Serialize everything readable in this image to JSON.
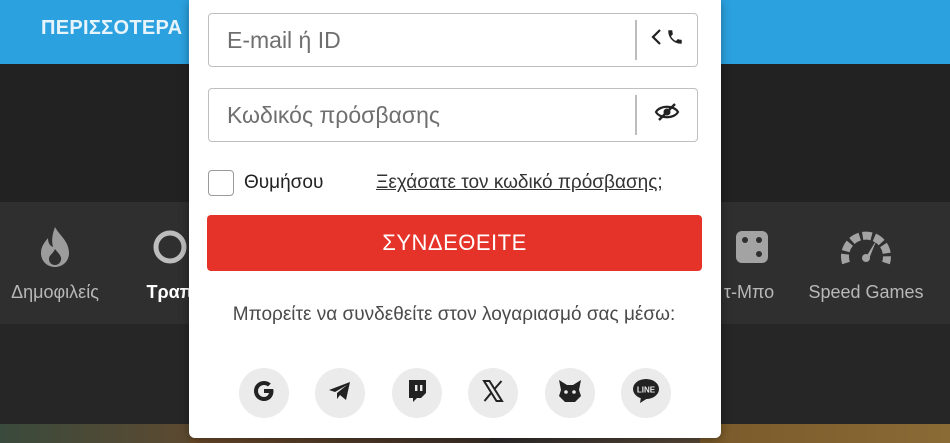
{
  "topbar": {
    "label": "ΠΕΡΙΣΣΟΤΕΡΑ"
  },
  "categories": [
    {
      "label": "Δημοφιλείς",
      "icon": "fire-icon"
    },
    {
      "label": "Τραπ",
      "icon": "cards-icon",
      "active": true
    },
    {
      "label": "τ-Μπο",
      "icon": "dice-icon"
    },
    {
      "label": "Speed Games",
      "icon": "speedometer-icon"
    }
  ],
  "login": {
    "email_placeholder": "E-mail ή ID",
    "password_placeholder": "Κωδικός πρόσβασης",
    "remember_label": "Θυμήσου",
    "forgot_link": "Ξεχάσατε τον κωδικό πρόσβασης;",
    "submit_label": "ΣΥΝΔΕΘΕΙΤΕ",
    "social_text": "Μπορείτε να συνδεθείτε στον λογαριασμό σας μέσω:",
    "socials": [
      {
        "icon": "google-icon"
      },
      {
        "icon": "telegram-icon"
      },
      {
        "icon": "twitch-icon"
      },
      {
        "icon": "x-icon"
      },
      {
        "icon": "metamask-icon"
      },
      {
        "icon": "line-icon"
      }
    ]
  },
  "colors": {
    "topbar": "#2ba1df",
    "primary_button": "#e6332a",
    "background": "#262626"
  }
}
